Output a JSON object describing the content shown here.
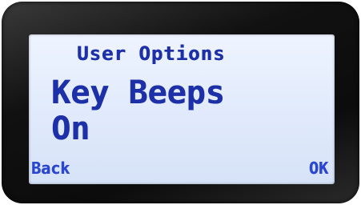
{
  "screen": {
    "title": "User Options",
    "setting_name": "Key Beeps",
    "setting_value": "On"
  },
  "softkeys": {
    "left_label": "Back",
    "right_label": "OK"
  },
  "colors": {
    "lcd_background": "#dfe9fb",
    "lcd_text": "#1d30a8",
    "bezel": "#111111"
  }
}
